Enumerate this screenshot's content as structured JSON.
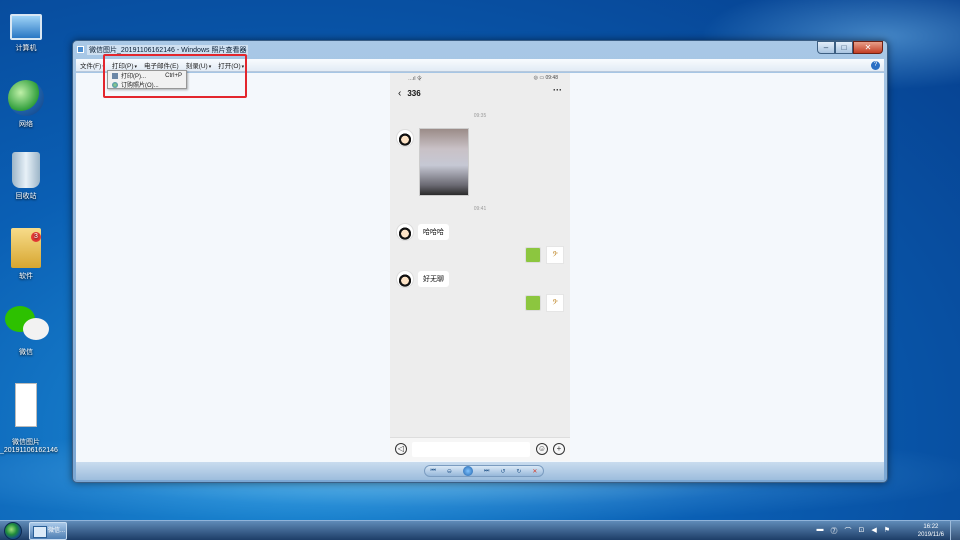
{
  "desktop": {
    "icons": [
      {
        "label": "计算机"
      },
      {
        "label": "网络"
      },
      {
        "label": "回收站"
      },
      {
        "label": "软件",
        "badge": "3"
      },
      {
        "label": "微信"
      },
      {
        "label": "微信图片\n_20191106162146"
      }
    ]
  },
  "window": {
    "title": "微信图片_20191106162146 - Windows 照片查看器",
    "buttons": {
      "minimize": "–",
      "maximize": "□",
      "close": "✕"
    },
    "menu": [
      {
        "label": "文件(F)",
        "arrow": "▾"
      },
      {
        "label": "打印(P)",
        "arrow": "▾"
      },
      {
        "label": "电子邮件(E)",
        "arrow": ""
      },
      {
        "label": "刻录(U)",
        "arrow": "▾"
      },
      {
        "label": "打开(O)",
        "arrow": "▾"
      }
    ],
    "help": "?",
    "print_menu": {
      "items": [
        {
          "label": "打印(P)...",
          "shortcut": "Ctrl+P"
        },
        {
          "label": "订购照片(O)...",
          "shortcut": ""
        }
      ]
    },
    "nav": {
      "prev": "⏮",
      "zoom": "⊖",
      "play": "",
      "next": "⏭",
      "rotl": "↺",
      "rotr": "↻",
      "del": "✕"
    }
  },
  "phone": {
    "status_left": "…ıl 令",
    "status_right": "◎ ▭ 09:48",
    "chat_title": "336",
    "back": "‹",
    "more": "···",
    "timestamps": [
      "09:35",
      "09:41"
    ],
    "messages": [
      {
        "text": "哈哈哈"
      },
      {
        "text": "好无聊"
      }
    ],
    "stickers": [
      "𝄢",
      "𝄢"
    ]
  },
  "taskbar": {
    "app_label": "微信...",
    "tray_icons": [
      "▬",
      "⓻",
      "⌒",
      "⊡",
      "◀",
      "⚑"
    ],
    "time": "16:22",
    "date": "2019/11/6"
  }
}
